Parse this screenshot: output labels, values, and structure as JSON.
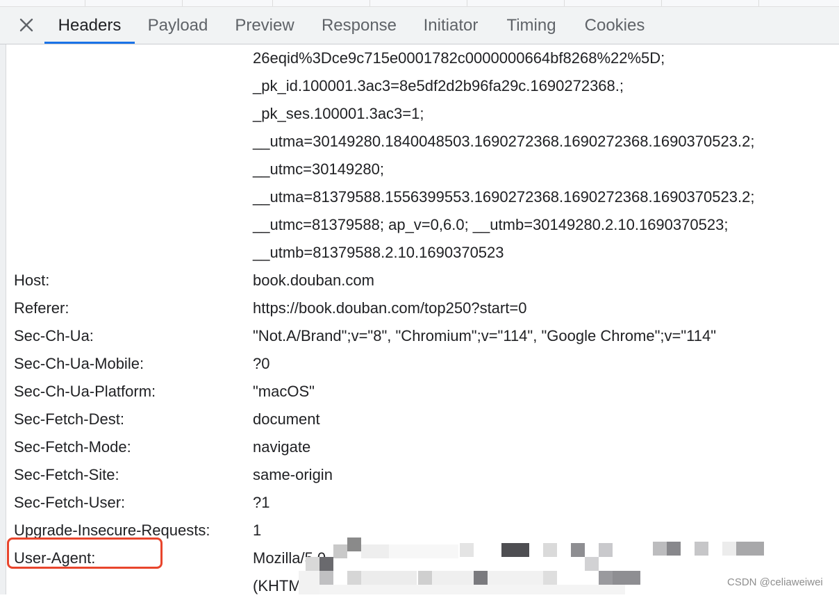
{
  "tabs": [
    {
      "label": "Headers"
    },
    {
      "label": "Payload"
    },
    {
      "label": "Preview"
    },
    {
      "label": "Response"
    },
    {
      "label": "Initiator"
    },
    {
      "label": "Timing"
    },
    {
      "label": "Cookies"
    }
  ],
  "active_tab": "Headers",
  "cookie_continuation": [
    "26eqid%3Dce9c715e0001782c0000000664bf8268%22%5D;",
    "_pk_id.100001.3ac3=8e5df2d2b96fa29c.1690272368.;",
    "_pk_ses.100001.3ac3=1;",
    "__utma=30149280.1840048503.1690272368.1690272368.1690370523.2;",
    "__utmc=30149280;",
    "__utma=81379588.1556399553.1690272368.1690272368.1690370523.2;",
    "__utmc=81379588; ap_v=0,6.0; __utmb=30149280.2.10.1690370523;",
    "__utmb=81379588.2.10.1690370523"
  ],
  "headers": [
    {
      "name": "Host:",
      "value": "book.douban.com"
    },
    {
      "name": "Referer:",
      "value": "https://book.douban.com/top250?start=0"
    },
    {
      "name": "Sec-Ch-Ua:",
      "value": "\"Not.A/Brand\";v=\"8\", \"Chromium\";v=\"114\", \"Google Chrome\";v=\"114\""
    },
    {
      "name": "Sec-Ch-Ua-Mobile:",
      "value": "?0"
    },
    {
      "name": "Sec-Ch-Ua-Platform:",
      "value": "\"macOS\""
    },
    {
      "name": "Sec-Fetch-Dest:",
      "value": "document"
    },
    {
      "name": "Sec-Fetch-Mode:",
      "value": "navigate"
    },
    {
      "name": "Sec-Fetch-Site:",
      "value": "same-origin"
    },
    {
      "name": "Sec-Fetch-User:",
      "value": "?1"
    },
    {
      "name": "Upgrade-Insecure-Requests:",
      "value": "1"
    },
    {
      "name": "User-Agent:",
      "value": "Mozilla/5.0"
    }
  ],
  "user_agent_continuation": "(KHTML",
  "watermark": "CSDN @celiaweiwei",
  "colors": {
    "active_tab_underline": "#1a73e8",
    "highlight_border": "#e8452c",
    "tab_bar_bg": "#f1f3f4"
  },
  "icons": {
    "close": "close-icon"
  }
}
